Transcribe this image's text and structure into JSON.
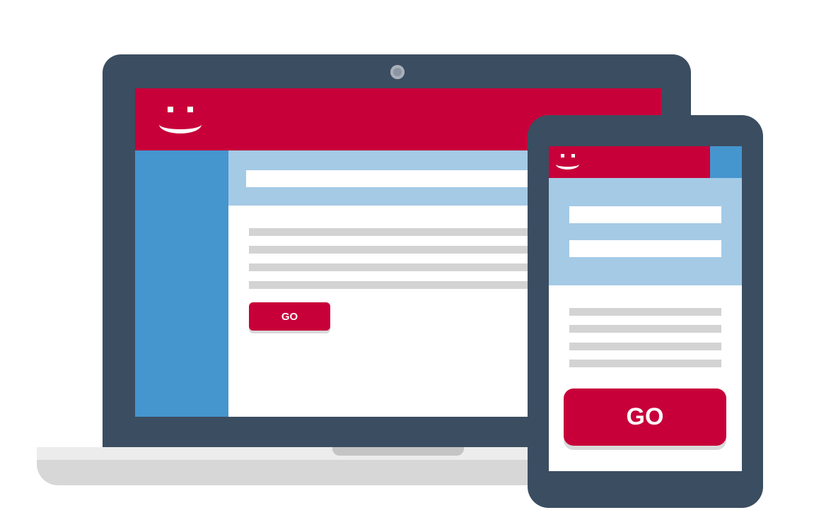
{
  "laptop": {
    "button_label": "GO",
    "text_line_count": 4
  },
  "tablet": {
    "button_label": "GO",
    "input_field_count": 2,
    "text_line_count": 4
  },
  "icons": {
    "logo": "smiley-face-icon",
    "camera": "webcam-icon"
  },
  "colors": {
    "brand_red": "#c8003a",
    "device_frame": "#3b4d60",
    "sidebar_blue": "#4595cf",
    "band_light_blue": "#a4cae6",
    "placeholder_gray": "#d3d3d3",
    "background": "#ffffff"
  }
}
